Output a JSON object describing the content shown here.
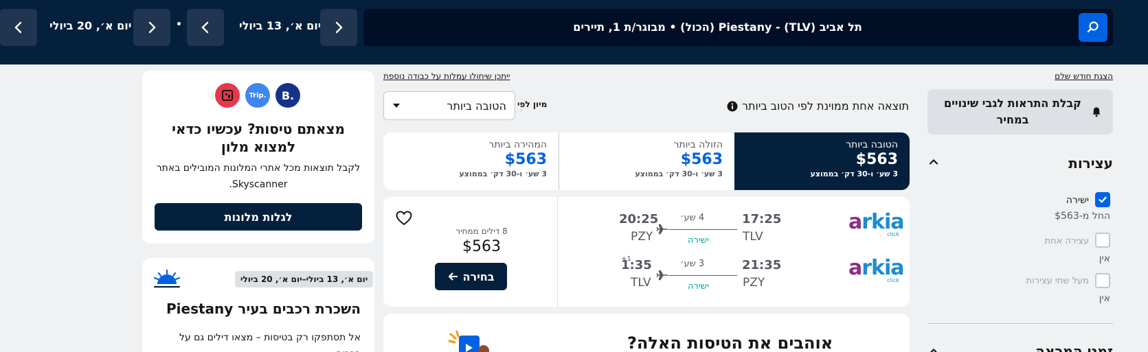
{
  "header": {
    "route_summary": "תל אביב (TLV) - Piestany (הכול)  •  מבוגר/ת 1, תיירים",
    "depart_date": "יום א׳, 13 ביולי",
    "return_date": "יום א׳, 20 ביולי",
    "separator": "•"
  },
  "left_sidebar": {
    "show_month_link": "הצגת חודש שלם",
    "price_alert_label": "קבלת התראות לגבי שינויים במחיר",
    "stops_title": "עצירות",
    "options": [
      {
        "label": "ישירה",
        "sub": "החל מ-$563",
        "checked": true
      },
      {
        "label": "עצירה אחת",
        "sub": "אין",
        "checked": false
      },
      {
        "label": "מעל שתי עצירות",
        "sub": "אין",
        "checked": false
      }
    ],
    "next_section_title": "זמני המראה"
  },
  "results": {
    "extra_fees_link": "ייתכן שיחולו עמלות על כבודה נוספת",
    "summary": "תוצאה אחת ממוינת לפי הטוב ביותר",
    "sort_label": "מיון לפי",
    "sort_value": "הטובה ביותר",
    "tabs": [
      {
        "label": "הטובה ביותר",
        "price": "$563",
        "duration": "3 שע׳ ו-30 דק׳ בממוצע",
        "active": true
      },
      {
        "label": "הזולה ביותר",
        "price": "$563",
        "duration": "3 שע׳ ו-30 דק׳ בממוצע",
        "active": false
      },
      {
        "label": "המהירה ביותר",
        "price": "$563",
        "duration": "3 שע׳ ו-30 דק׳ בממוצע",
        "active": false
      }
    ],
    "flight": {
      "airline": "arkia",
      "airline_sub": "click",
      "legs": [
        {
          "dep_time": "17:25",
          "dep_code": "TLV",
          "arr_time": "20:25",
          "arr_code": "PZY",
          "duration": "4 שע׳",
          "stops": "ישירה",
          "day_offset": ""
        },
        {
          "dep_time": "21:35",
          "dep_code": "PZY",
          "arr_time": "1:35",
          "arr_code": "TLV",
          "duration": "3 שע׳",
          "stops": "ישירה",
          "day_offset": "+1"
        }
      ],
      "deals": "8 דילים ממחיר",
      "price": "$563",
      "select_label": "בחירה"
    },
    "love_banner": "אוהבים את הטיסות האלה?"
  },
  "right_sidebar": {
    "hotel_card": {
      "logos": [
        "B.",
        "Trip.",
        "H"
      ],
      "title": "מצאתם טיסות? עכשיו כדאי למצוא מלון",
      "body": "לקבל תוצאות מכל אתרי המלונות המובילים באתר Skyscanner.",
      "button": "לגלות מלונות"
    },
    "car_card": {
      "dates": "יום א׳, 13 ביולי–יום א׳, 20 ביולי",
      "title": "השכרת רכבים בעיר Piestany",
      "body": "אל תסתפקו רק בטיסות – מצאו דילים גם על רכבים"
    }
  },
  "colors": {
    "header_bg": "#05203c",
    "accent_blue": "#0062e3",
    "teal": "#00a698",
    "page_bg": "#eff1f2"
  },
  "icons": [
    "search-icon",
    "chevron-left-icon",
    "chevron-right-icon",
    "bell-icon",
    "info-icon",
    "heart-icon",
    "plane-icon",
    "arrow-left-icon",
    "chevron-up-icon",
    "chevron-down-icon",
    "check-icon",
    "sun-icon"
  ]
}
